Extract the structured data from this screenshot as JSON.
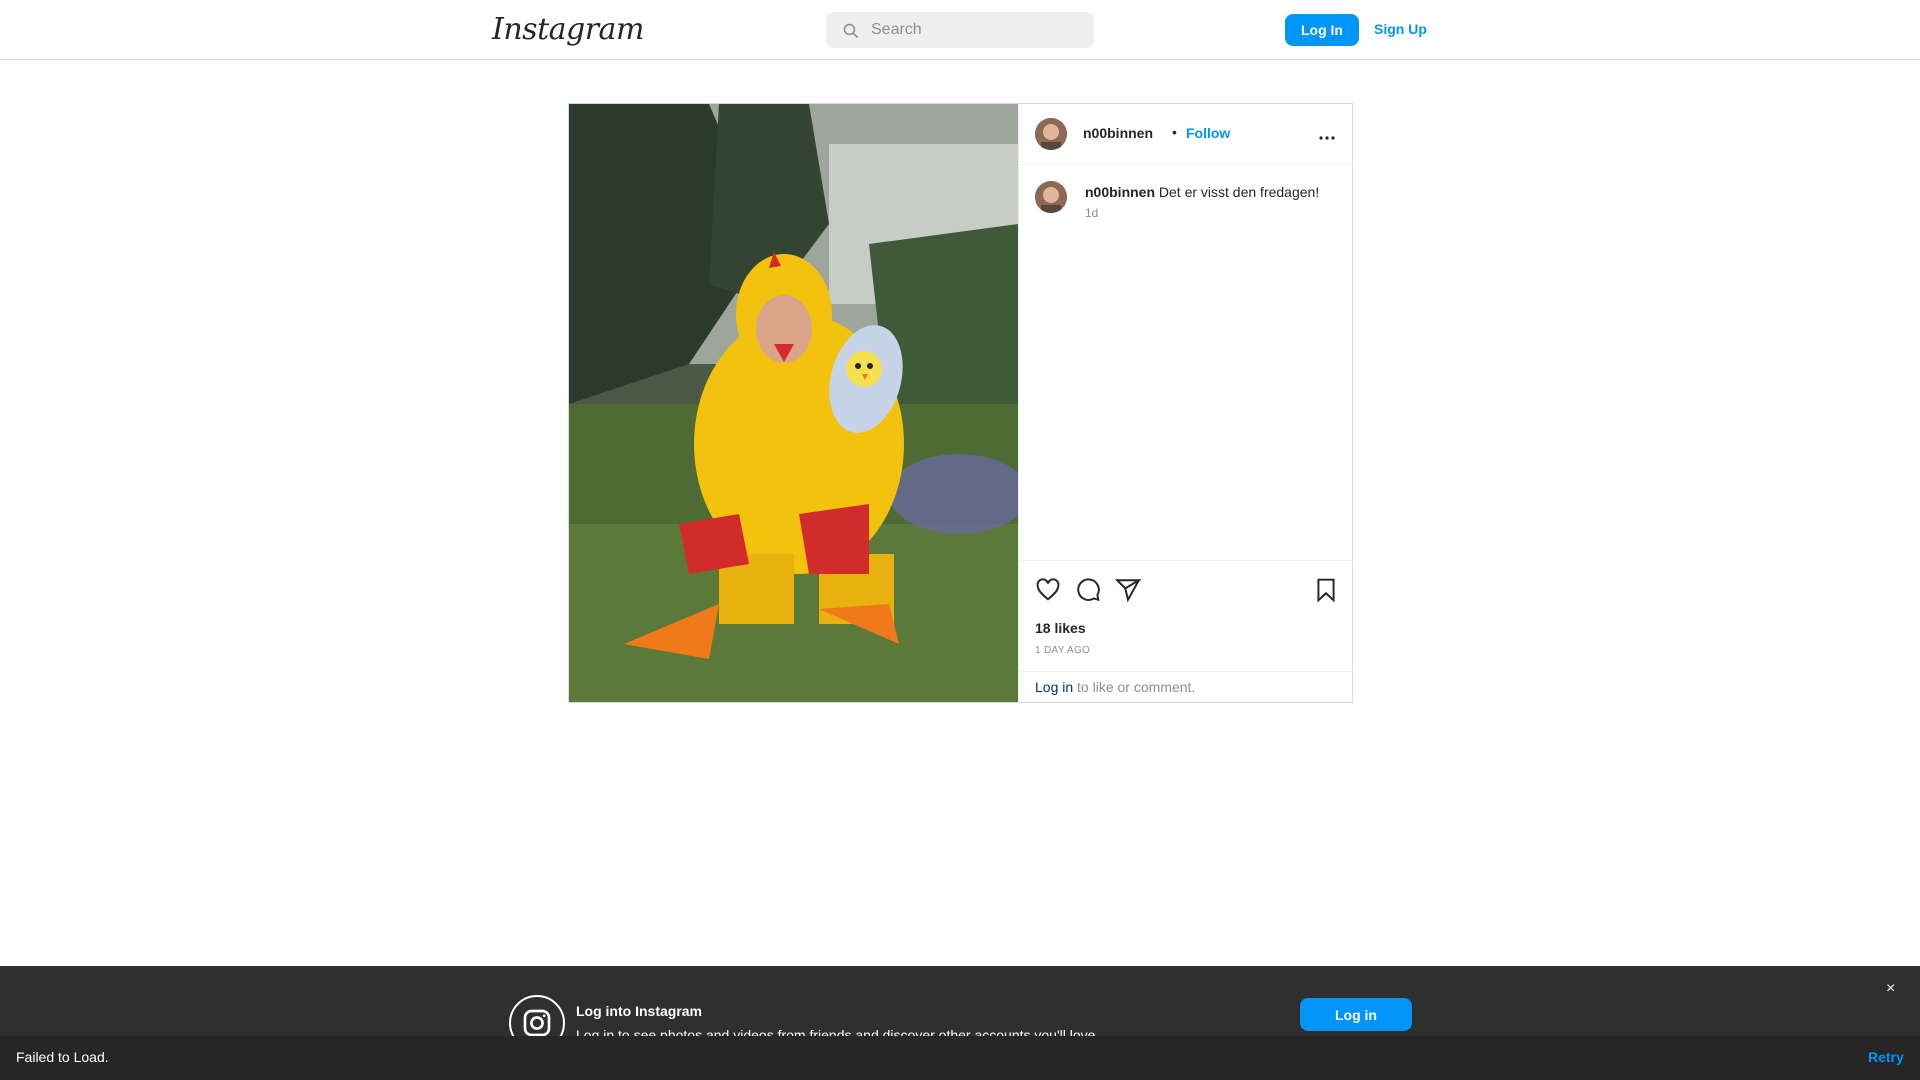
{
  "header": {
    "logo": "Instagram",
    "search_placeholder": "Search",
    "login_label": "Log In",
    "signup_label": "Sign Up"
  },
  "post": {
    "username": "n00binnen",
    "separator": "•",
    "follow_label": "Follow",
    "caption": "Det er visst den fredagen!",
    "caption_time": "1d",
    "likes": "18 likes",
    "posted_ago": "1 DAY AGO",
    "login_link": "Log in",
    "login_suffix": " to like or comment.",
    "icons": [
      "heart-icon",
      "comment-icon",
      "share-icon",
      "bookmark-icon",
      "more-options-icon"
    ]
  },
  "banner": {
    "title": "Log into Instagram",
    "subtitle": "Log in to see photos and videos from friends and discover other accounts you'll love.",
    "login_label": "Log in",
    "close_label": "×"
  },
  "toast": {
    "message": "Failed to Load.",
    "retry_label": "Retry"
  },
  "colors": {
    "accent": "#0095f6",
    "link": "#00376b",
    "muted": "#8e8e8e",
    "border": "#dbdbdb"
  }
}
